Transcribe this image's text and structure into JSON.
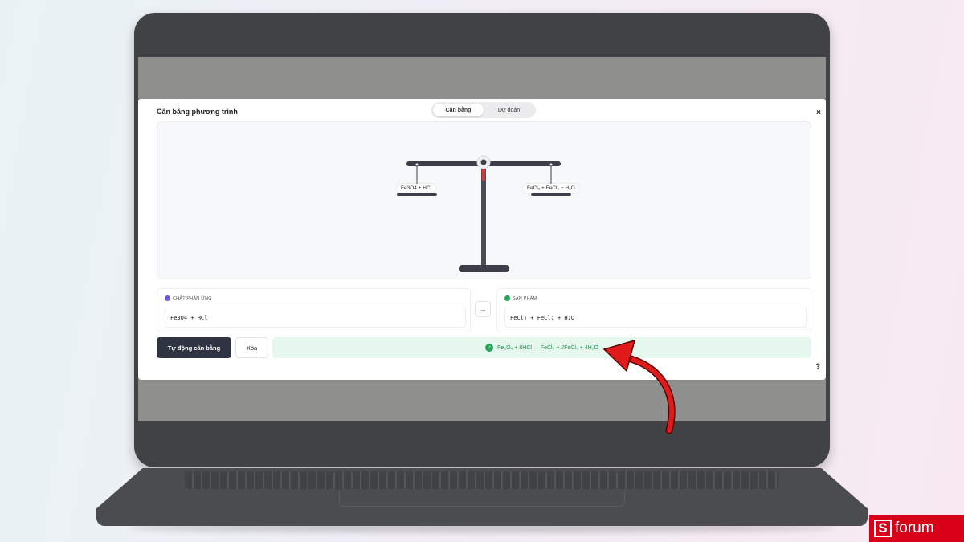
{
  "modal": {
    "title": "Cân bằng phương trình",
    "tabs": [
      {
        "label": "Cân bằng",
        "active": true
      },
      {
        "label": "Dự đoán",
        "active": false
      }
    ],
    "close_label": "×",
    "help_label": "?"
  },
  "scale": {
    "left_label": "Fe3O4 + HCl",
    "right_label": "FeCl₂ + FeCl₃ + H₂O"
  },
  "reactants": {
    "badge": "R",
    "label": "CHẤT PHẢN ỨNG",
    "value": "Fe3O4 + HCl"
  },
  "products": {
    "badge": "P",
    "label": "SẢN PHẨM",
    "value": "FeCl₂ + FeCl₃ + H₂O"
  },
  "arrow_icon": "arrow-right-icon",
  "actions": {
    "auto_balance_label": "Tự động cân bằng",
    "clear_label": "Xóa"
  },
  "result": {
    "check": "✓",
    "equation": "Fe₃O₄ + 8HCl → FeCl₂ + 2FeCl₃ + 4H₂O"
  },
  "watermark": {
    "letter": "S",
    "text": "forum"
  },
  "colors": {
    "primary_button": "#2f3342",
    "success_bg": "#e6f8ee",
    "success_text": "#1f8f4f",
    "reactant_badge": "#6b5bd6",
    "product_badge": "#27a35a",
    "annotation_arrow": "#e01b1b",
    "brand_red": "#d70018"
  }
}
